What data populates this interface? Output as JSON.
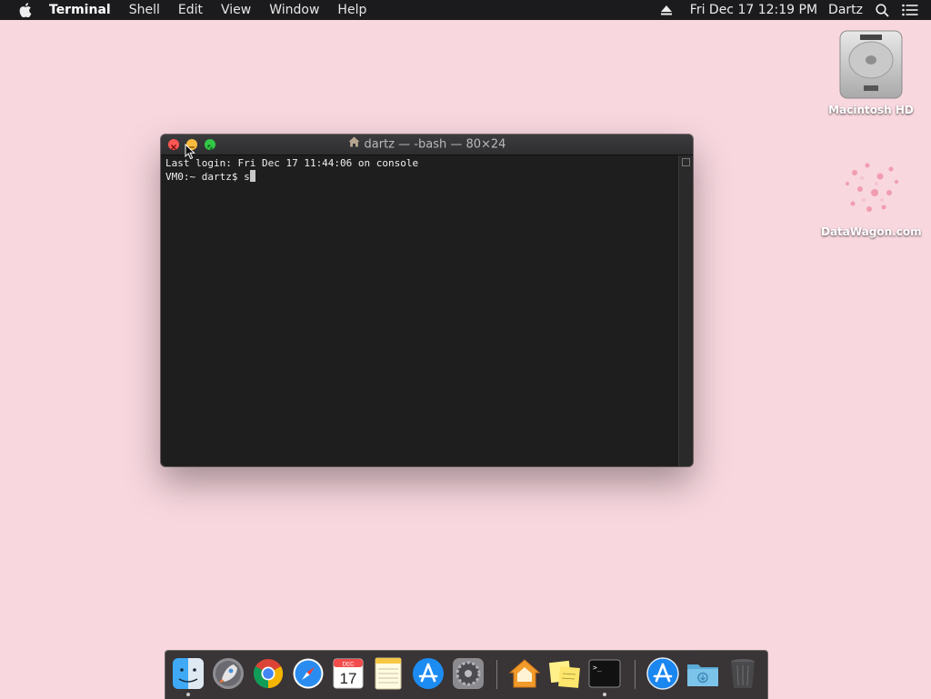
{
  "menubar": {
    "app_name": "Terminal",
    "menus": [
      "Shell",
      "Edit",
      "View",
      "Window",
      "Help"
    ],
    "datetime": "Fri Dec 17  12:19 PM",
    "user": "Dartz",
    "icons": [
      "apple-icon",
      "eject-icon",
      "spotlight-search-icon",
      "notification-center-icon"
    ]
  },
  "desktop": {
    "icons": [
      {
        "label": "Macintosh HD",
        "icon": "hard-drive-icon"
      },
      {
        "label": "DataWagon.com",
        "icon": "pink-flowers-image-icon"
      }
    ]
  },
  "terminal": {
    "title": "dartz — -bash — 80×24",
    "lines": [
      "Last login: Fri Dec 17 11:44:06 on console",
      "VM0:~ dartz$ s"
    ]
  },
  "dock": {
    "items": [
      {
        "name": "finder",
        "icon": "finder-icon",
        "running": true
      },
      {
        "name": "launchpad",
        "icon": "rocket-icon",
        "running": false
      },
      {
        "name": "chrome",
        "icon": "chrome-icon",
        "running": false
      },
      {
        "name": "safari",
        "icon": "compass-icon",
        "running": false
      },
      {
        "name": "calendar",
        "icon": "calendar-icon",
        "running": false,
        "month": "DEC",
        "day": "17"
      },
      {
        "name": "notes",
        "icon": "notes-icon",
        "running": false
      },
      {
        "name": "app-store",
        "icon": "app-store-icon",
        "running": false
      },
      {
        "name": "system-preferences",
        "icon": "gear-icon",
        "running": false
      },
      {
        "name": "home",
        "icon": "home-icon",
        "running": false
      },
      {
        "name": "stickies",
        "icon": "stickies-icon",
        "running": false
      },
      {
        "name": "terminal",
        "icon": "terminal-icon",
        "running": true
      },
      {
        "name": "downloads",
        "icon": "app-store-icon",
        "running": false
      },
      {
        "name": "folder",
        "icon": "folder-icon",
        "running": false
      },
      {
        "name": "trash",
        "icon": "trash-icon",
        "running": false
      }
    ]
  },
  "colors": {
    "desktop": "#f8d7df",
    "menubar": "#1b1b1d",
    "terminal_bg": "#1e1e1e",
    "close": "#fc5753",
    "minimize": "#fdbc40",
    "zoom": "#33c748"
  }
}
